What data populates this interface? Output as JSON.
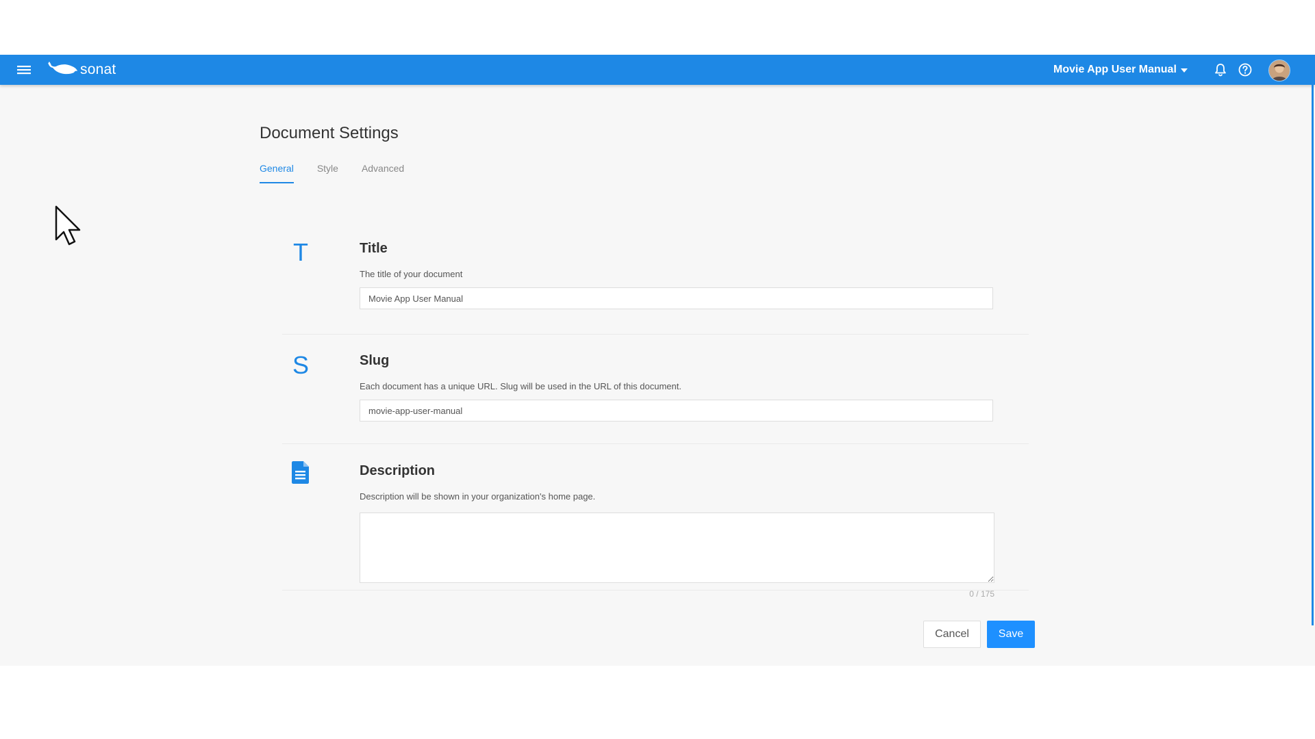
{
  "app": {
    "brand": "sonat",
    "document_switcher": "Movie App User Manual",
    "accent_color": "#1e88e5",
    "icons": {
      "menu": "hamburger-menu-icon",
      "logo": "whale-logo-icon",
      "notifications": "bell-icon",
      "help": "help-circle-icon",
      "avatar": "user-avatar"
    }
  },
  "page": {
    "title": "Document Settings",
    "tabs": [
      {
        "label": "General",
        "active": true
      },
      {
        "label": "Style",
        "active": false
      },
      {
        "label": "Advanced",
        "active": false
      }
    ]
  },
  "sections": {
    "title": {
      "icon": "T",
      "heading": "Title",
      "description": "The title of your document",
      "value": "Movie App User Manual"
    },
    "slug": {
      "icon": "S",
      "heading": "Slug",
      "description": "Each document has a unique URL. Slug will be used in the URL of this document.",
      "value": "movie-app-user-manual"
    },
    "description": {
      "icon": "document-icon",
      "heading": "Description",
      "description": "Description will be shown in your organization's home page.",
      "value": "",
      "counter": "0 / 175"
    }
  },
  "actions": {
    "cancel": "Cancel",
    "save": "Save"
  }
}
